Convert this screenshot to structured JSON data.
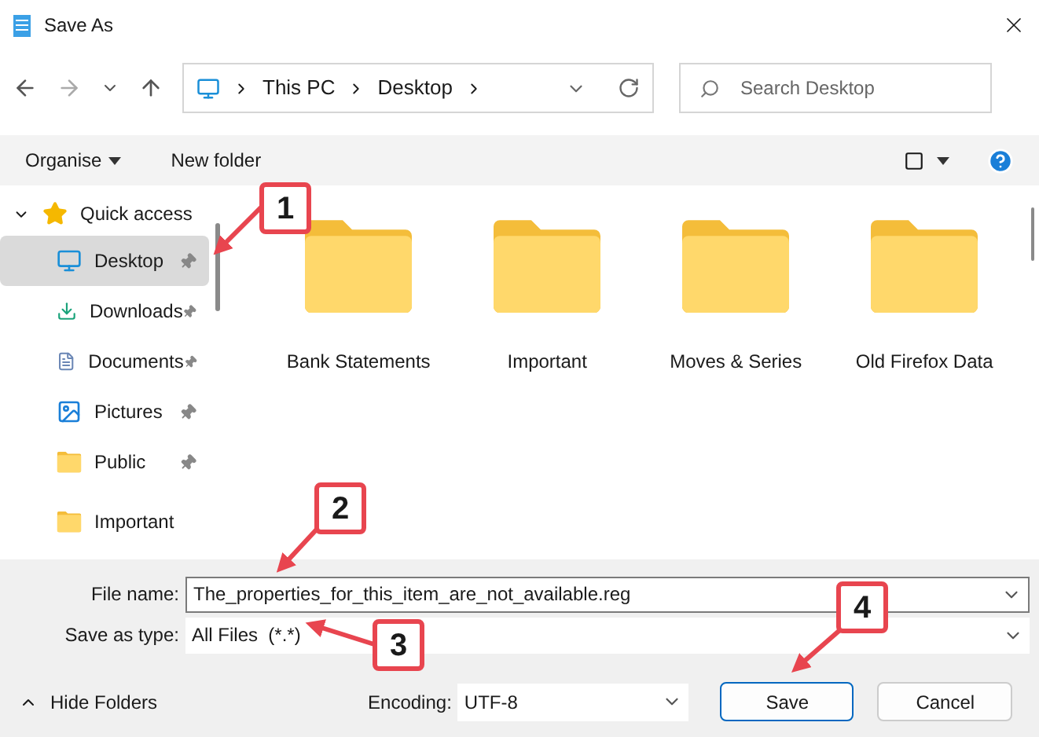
{
  "window": {
    "title": "Save As"
  },
  "address_bar": {
    "segments": [
      "This PC",
      "Desktop"
    ]
  },
  "search": {
    "placeholder": "Search Desktop"
  },
  "toolbar": {
    "buttons": [
      "Organise",
      "New folder"
    ]
  },
  "sidebar": {
    "items": [
      {
        "label": "Quick access",
        "kind": "group",
        "expanded": true,
        "children": [
          {
            "label": "Desktop",
            "kind": "desktop",
            "selected": true
          },
          {
            "label": "Downloads",
            "kind": "downloads",
            "selected": false
          },
          {
            "label": "Documents",
            "kind": "documents",
            "selected": false
          },
          {
            "label": "Pictures",
            "kind": "pictures",
            "selected": false
          },
          {
            "label": "Public",
            "kind": "folder",
            "selected": false
          }
        ]
      },
      {
        "label": "Important",
        "kind": "folder",
        "selected": false
      }
    ]
  },
  "folders": [
    {
      "name": "Bank Statements"
    },
    {
      "name": "Important"
    },
    {
      "name": "Moves & Series"
    },
    {
      "name": "Old Firefox Data"
    }
  ],
  "form": {
    "file_name_label": "File name:",
    "file_name": "The_properties_for_this_item_are_not_available.reg",
    "type_label": "Save as type:",
    "type": "All Files  (*.*)"
  },
  "footer": {
    "hide_folders": "Hide Folders",
    "encoding_label": "Encoding:",
    "encoding": "UTF-8",
    "buttons": [
      "Save",
      "Cancel"
    ]
  },
  "callouts": [
    {
      "label": "1"
    },
    {
      "label": "2"
    },
    {
      "label": "3"
    },
    {
      "label": "4"
    }
  ]
}
